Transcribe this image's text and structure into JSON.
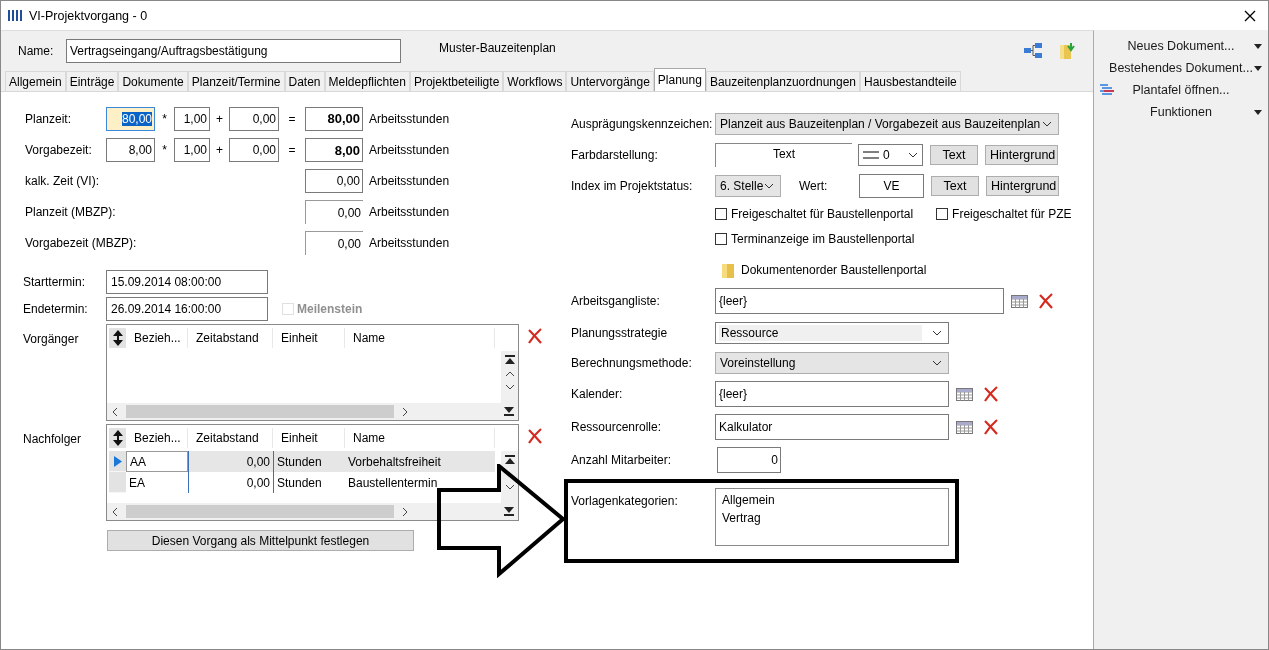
{
  "window": {
    "title": "VI-Projektvorgang - 0"
  },
  "header": {
    "name_label": "Name:",
    "name_value": "Vertragseingang/Auftragsbestätigung",
    "plan_name": "Muster-Bauzeitenplan"
  },
  "tabs": [
    {
      "label": "Allgemein",
      "selected": false
    },
    {
      "label": "Einträge",
      "selected": false
    },
    {
      "label": "Dokumente",
      "selected": false
    },
    {
      "label": "Planzeit/Termine",
      "selected": false
    },
    {
      "label": "Daten",
      "selected": false
    },
    {
      "label": "Meldepflichten",
      "selected": false
    },
    {
      "label": "Projektbeteiligte",
      "selected": false
    },
    {
      "label": "Workflows",
      "selected": false
    },
    {
      "label": "Untervorgänge",
      "selected": false
    },
    {
      "label": "Planung",
      "selected": true
    },
    {
      "label": "Bauzeitenplanzuordnungen",
      "selected": false
    },
    {
      "label": "Hausbestandteile",
      "selected": false
    }
  ],
  "time_rows": [
    {
      "kind": "formula",
      "label": "Planzeit:",
      "base": "80,00",
      "focused": true,
      "op1": "*",
      "factor": "1,00",
      "op2": "+",
      "addend": "0,00",
      "eq": "=",
      "result": "80,00",
      "unit": "Arbeitsstunden"
    },
    {
      "kind": "formula",
      "label": "Vorgabezeit:",
      "base": "8,00",
      "focused": false,
      "op1": "*",
      "factor": "1,00",
      "op2": "+",
      "addend": "0,00",
      "eq": "=",
      "result": "8,00",
      "unit": "Arbeitsstunden"
    },
    {
      "kind": "input",
      "label": "kalk. Zeit (VI):",
      "result": "0,00",
      "unit": "Arbeitsstunden"
    },
    {
      "kind": "readonly",
      "label": "Planzeit (MBZP):",
      "result": "0,00",
      "unit": "Arbeitsstunden"
    },
    {
      "kind": "readonly",
      "label": "Vorgabezeit (MBZP):",
      "result": "0,00",
      "unit": "Arbeitsstunden"
    }
  ],
  "dates": {
    "start_label": "Starttermin:",
    "start": "15.09.2014 08:00:00",
    "end_label": "Endetermin:",
    "end": "26.09.2014 16:00:00",
    "milestone": {
      "label": "Meilenstein",
      "checked": false,
      "disabled": true
    }
  },
  "grids": [
    {
      "label": "Vorgänger",
      "columns": [
        "Bezieh...",
        "Zeitabstand",
        "Einheit",
        "Name"
      ]
    },
    {
      "label": "Nachfolger",
      "columns": [
        "Bezieh...",
        "Zeitabstand",
        "Einheit",
        "Name"
      ],
      "rows": [
        {
          "cells": [
            "AA",
            "0,00",
            "Stunden",
            "Vorbehaltsfreiheit"
          ],
          "selected": true
        },
        {
          "cells": [
            "EA",
            "0,00",
            "Stunden",
            "Baustellentermin"
          ],
          "selected": false
        }
      ]
    }
  ],
  "center_button": "Diesen Vorgang als Mittelpunkt festlegen",
  "planning": {
    "auspraegung": {
      "label": "Ausprägungskennzeichen:",
      "value": "Planzeit aus Bauzeitenplan / Vorgabezeit aus Bauzeitenplan"
    },
    "farb": {
      "label": "Farbdarstellung:",
      "preview": "Text",
      "line_value": "0",
      "text_button": "Text",
      "bg_button": "Hintergrund"
    },
    "index": {
      "label": "Index im Projektstatus:",
      "value": "6. Stelle",
      "wert_label": "Wert:",
      "wert": "VE",
      "text_button": "Text",
      "bg_button": "Hintergrund"
    },
    "checkboxes": [
      {
        "label": "Freigeschaltet für Baustellenportal",
        "checked": false
      },
      {
        "label": "Freigeschaltet für PZE",
        "checked": false
      },
      {
        "label": "Terminanzeige im Baustellenportal",
        "checked": false
      }
    ],
    "folder_link": "Dokumentenorder Baustellenportal",
    "arbeitsgang": {
      "label": "Arbeitsgangliste:",
      "value": "{leer}"
    },
    "strategie": {
      "label": "Planungsstrategie",
      "value": "Ressource"
    },
    "methode": {
      "label": "Berechnungsmethode:",
      "value": "Voreinstellung"
    },
    "kalender": {
      "label": "Kalender:",
      "value": "{leer}"
    },
    "rolle": {
      "label": "Ressourcenrolle:",
      "value": "Kalkulator"
    },
    "anzahl": {
      "label": "Anzahl Mitarbeiter:",
      "value": "0"
    },
    "vorlagen": {
      "label": "Vorlagenkategorien:",
      "items": [
        "Allgemein",
        "Vertrag"
      ]
    }
  },
  "sidebar": [
    {
      "label": "Neues Dokument...",
      "kind": "dropdown"
    },
    {
      "label": "Bestehendes Dokument...",
      "kind": "dropdown"
    },
    {
      "label": "Plantafel öffnen...",
      "kind": "icon"
    },
    {
      "label": "Funktionen",
      "kind": "dropdown"
    }
  ]
}
